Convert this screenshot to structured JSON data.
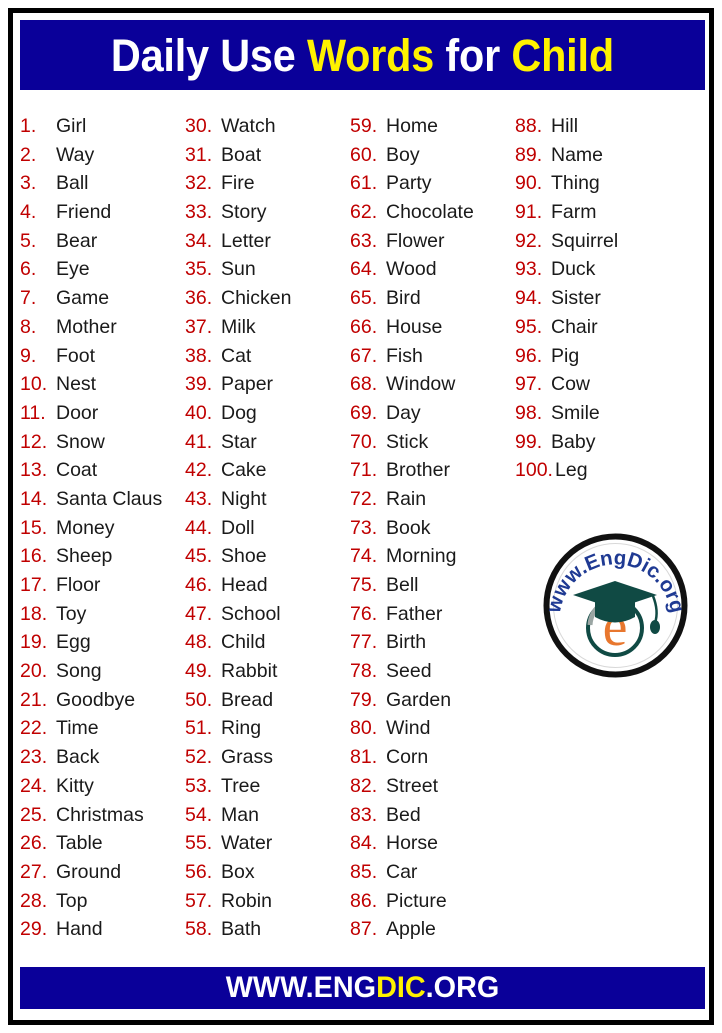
{
  "header": {
    "title_part1": "Daily Use ",
    "title_part2": "Words",
    "title_part3": " for ",
    "title_part4": "Child",
    "banner_color": "#0A0099",
    "white_color": "#FFFFFF",
    "yellow_color": "#FFF200"
  },
  "list": {
    "number_color": "#C00000",
    "word_color": "#1A1A1A",
    "columns": [
      {
        "items": [
          {
            "num": "1.",
            "word": "Girl"
          },
          {
            "num": "2.",
            "word": "Way"
          },
          {
            "num": "3.",
            "word": "Ball"
          },
          {
            "num": "4.",
            "word": "Friend"
          },
          {
            "num": "5.",
            "word": "Bear"
          },
          {
            "num": "6.",
            "word": "Eye"
          },
          {
            "num": "7.",
            "word": "Game"
          },
          {
            "num": "8.",
            "word": "Mother"
          },
          {
            "num": "9.",
            "word": "Foot"
          },
          {
            "num": "10.",
            "word": "Nest"
          },
          {
            "num": "11.",
            "word": "Door"
          },
          {
            "num": "12.",
            "word": "Snow"
          },
          {
            "num": "13.",
            "word": "Coat"
          },
          {
            "num": "14.",
            "word": "Santa Claus"
          },
          {
            "num": "15.",
            "word": "Money"
          },
          {
            "num": "16.",
            "word": "Sheep"
          },
          {
            "num": "17.",
            "word": "Floor"
          },
          {
            "num": "18.",
            "word": "Toy"
          },
          {
            "num": "19.",
            "word": "Egg"
          },
          {
            "num": "20.",
            "word": "Song"
          },
          {
            "num": "21.",
            "word": "Goodbye"
          },
          {
            "num": "22.",
            "word": "Time"
          },
          {
            "num": "23.",
            "word": "Back"
          },
          {
            "num": "24.",
            "word": "Kitty"
          },
          {
            "num": "25.",
            "word": "Christmas"
          },
          {
            "num": "26.",
            "word": "Table"
          },
          {
            "num": "27.",
            "word": "Ground"
          },
          {
            "num": "28.",
            "word": "Top"
          },
          {
            "num": "29.",
            "word": "Hand"
          }
        ]
      },
      {
        "items": [
          {
            "num": "30.",
            "word": "Watch"
          },
          {
            "num": "31.",
            "word": "Boat"
          },
          {
            "num": "32.",
            "word": "Fire"
          },
          {
            "num": "33.",
            "word": "Story"
          },
          {
            "num": "34.",
            "word": "Letter"
          },
          {
            "num": "35.",
            "word": "Sun"
          },
          {
            "num": "36.",
            "word": "Chicken"
          },
          {
            "num": "37.",
            "word": "Milk"
          },
          {
            "num": "38.",
            "word": "Cat"
          },
          {
            "num": "39.",
            "word": "Paper"
          },
          {
            "num": "40.",
            "word": "Dog"
          },
          {
            "num": "41.",
            "word": "Star"
          },
          {
            "num": "42.",
            "word": "Cake"
          },
          {
            "num": "43.",
            "word": "Night"
          },
          {
            "num": "44.",
            "word": "Doll"
          },
          {
            "num": "45.",
            "word": "Shoe"
          },
          {
            "num": "46.",
            "word": "Head"
          },
          {
            "num": "47.",
            "word": "School"
          },
          {
            "num": "48.",
            "word": "Child"
          },
          {
            "num": "49.",
            "word": "Rabbit"
          },
          {
            "num": "50.",
            "word": "Bread"
          },
          {
            "num": "51.",
            "word": "Ring"
          },
          {
            "num": "52.",
            "word": "Grass"
          },
          {
            "num": "53.",
            "word": "Tree"
          },
          {
            "num": "54.",
            "word": "Man"
          },
          {
            "num": "55.",
            "word": "Water"
          },
          {
            "num": "56.",
            "word": "Box"
          },
          {
            "num": "57.",
            "word": "Robin"
          },
          {
            "num": "58.",
            "word": "Bath"
          }
        ]
      },
      {
        "items": [
          {
            "num": "59.",
            "word": "Home"
          },
          {
            "num": "60.",
            "word": "Boy"
          },
          {
            "num": "61.",
            "word": "Party"
          },
          {
            "num": "62.",
            "word": "Chocolate"
          },
          {
            "num": "63.",
            "word": "Flower"
          },
          {
            "num": "64.",
            "word": "Wood"
          },
          {
            "num": "65.",
            "word": "Bird"
          },
          {
            "num": "66.",
            "word": "House"
          },
          {
            "num": "67.",
            "word": "Fish"
          },
          {
            "num": "68.",
            "word": "Window"
          },
          {
            "num": "69.",
            "word": "Day"
          },
          {
            "num": "70.",
            "word": "Stick"
          },
          {
            "num": "71.",
            "word": "Brother"
          },
          {
            "num": "72.",
            "word": "Rain"
          },
          {
            "num": "73.",
            "word": "Book"
          },
          {
            "num": "74.",
            "word": "Morning"
          },
          {
            "num": "75.",
            "word": "Bell"
          },
          {
            "num": "76.",
            "word": "Father"
          },
          {
            "num": "77.",
            "word": "Birth"
          },
          {
            "num": "78.",
            "word": "Seed"
          },
          {
            "num": "79.",
            "word": "Garden"
          },
          {
            "num": "80.",
            "word": "Wind"
          },
          {
            "num": "81.",
            "word": "Corn"
          },
          {
            "num": "82.",
            "word": "Street"
          },
          {
            "num": "83.",
            "word": "Bed"
          },
          {
            "num": "84.",
            "word": "Horse"
          },
          {
            "num": "85.",
            "word": "Car"
          },
          {
            "num": "86.",
            "word": "Picture"
          },
          {
            "num": "87.",
            "word": "Apple"
          }
        ]
      },
      {
        "items": [
          {
            "num": "88.",
            "word": "Hill"
          },
          {
            "num": "89.",
            "word": "Name"
          },
          {
            "num": "90.",
            "word": "Thing"
          },
          {
            "num": "91.",
            "word": "Farm"
          },
          {
            "num": "92.",
            "word": "Squirrel"
          },
          {
            "num": "93.",
            "word": "Duck"
          },
          {
            "num": "94.",
            "word": "Sister"
          },
          {
            "num": "95.",
            "word": "Chair"
          },
          {
            "num": "96.",
            "word": "Pig"
          },
          {
            "num": "97.",
            "word": "Cow"
          },
          {
            "num": "98.",
            "word": "Smile"
          },
          {
            "num": "99.",
            "word": "Baby"
          },
          {
            "num": "100.",
            "word": "Leg"
          }
        ]
      }
    ]
  },
  "logo": {
    "curved_text": "www.EngDic.org",
    "letter": "e",
    "ring_color": "#111111",
    "text_color": "#1F3A93",
    "cap_color": "#104A44",
    "letter_color": "#E8772E"
  },
  "footer": {
    "text_part1": "WWW.ENG",
    "text_part2": "DIC",
    "text_part3": ".ORG",
    "banner_color": "#0A0099"
  }
}
